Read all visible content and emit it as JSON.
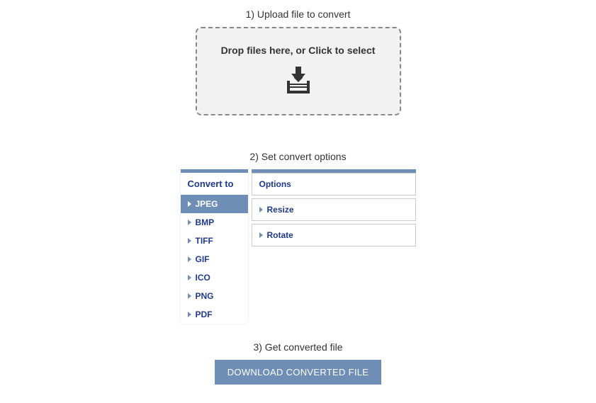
{
  "step1": {
    "title": "1) Upload file to convert",
    "dropzone_text": "Drop files here, or Click to select"
  },
  "step2": {
    "title": "2) Set convert options",
    "formats_title": "Convert to",
    "formats": [
      {
        "label": "JPEG",
        "active": true
      },
      {
        "label": "BMP",
        "active": false
      },
      {
        "label": "TIFF",
        "active": false
      },
      {
        "label": "GIF",
        "active": false
      },
      {
        "label": "ICO",
        "active": false
      },
      {
        "label": "PNG",
        "active": false
      },
      {
        "label": "PDF",
        "active": false
      }
    ],
    "options_title": "Options",
    "options": [
      {
        "label": "Resize"
      },
      {
        "label": "Rotate"
      }
    ]
  },
  "step3": {
    "title": "3) Get converted file",
    "download_label": "DOWNLOAD CONVERTED FILE"
  }
}
